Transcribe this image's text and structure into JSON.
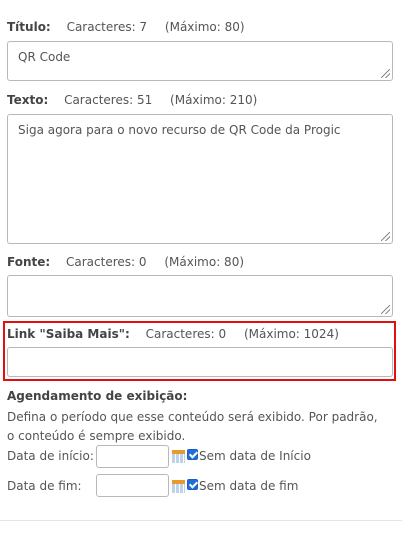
{
  "fields": {
    "titulo": {
      "label": "Título:",
      "chars": "Caracteres: 7",
      "max": "(Máximo: 80)",
      "value": "QR Code"
    },
    "texto": {
      "label": "Texto:",
      "chars": "Caracteres: 51",
      "max": "(Máximo: 210)",
      "value": "Siga agora para o novo recurso de QR Code da Progic"
    },
    "fonte": {
      "label": "Fonte:",
      "chars": "Caracteres: 0",
      "max": "(Máximo: 80)",
      "value": ""
    },
    "link": {
      "label": "Link \"Saiba Mais\":",
      "chars": "Caracteres: 0",
      "max": "(Máximo: 1024)",
      "value": ""
    }
  },
  "schedule": {
    "heading": "Agendamento de exibição:",
    "description": "Defina o período que esse conteúdo será exibido. Por padrão, o conteúdo é sempre exibido.",
    "start": {
      "label": "Data de início:",
      "value": "",
      "checkbox_label": "Sem data de Início",
      "checked": true
    },
    "end": {
      "label": "Data de fim:",
      "value": "",
      "checkbox_label": "Sem data de fim",
      "checked": true
    }
  },
  "icons": {
    "calendar": "calendar-icon",
    "highlight_color": "#e01010",
    "checkbox_color": "#1e6fd9"
  }
}
